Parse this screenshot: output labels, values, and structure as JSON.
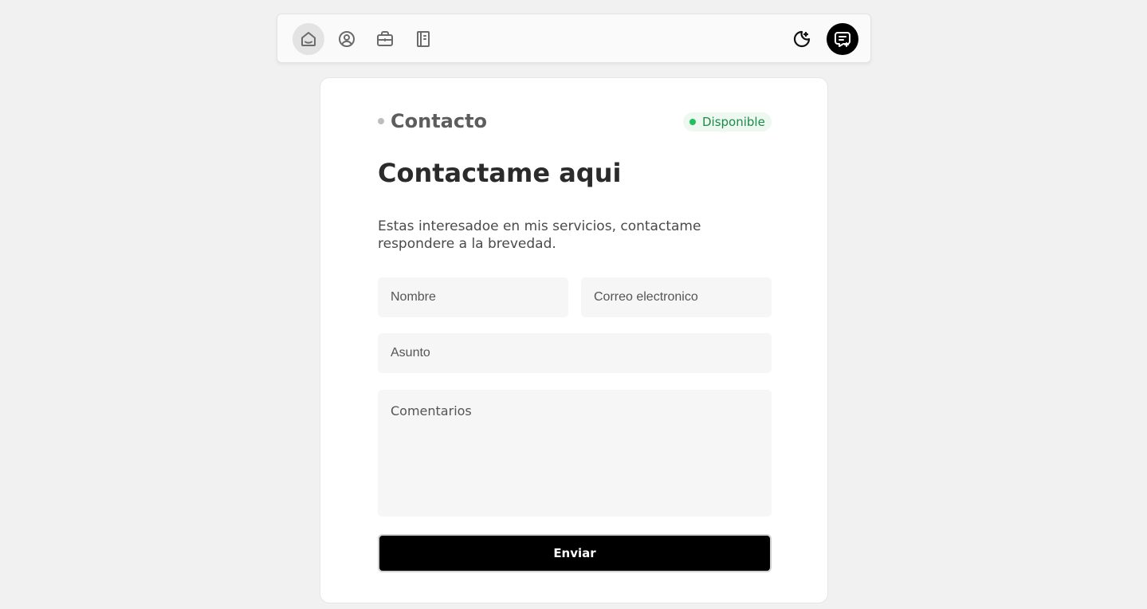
{
  "nav": {
    "items": [
      {
        "icon": "home-icon",
        "active": true
      },
      {
        "icon": "user-circle-icon",
        "active": false
      },
      {
        "icon": "briefcase-icon",
        "active": false
      },
      {
        "icon": "notebook-icon",
        "active": false
      }
    ],
    "theme_icon": "moon-icon",
    "chat_icon": "message-plus-icon"
  },
  "contact": {
    "section_label": "Contacto",
    "status_badge": "Disponible",
    "heading": "Contactame aqui",
    "description": "Estas interesadoe en mis servicios, contactame respondere a la brevedad.",
    "form": {
      "name_placeholder": "Nombre",
      "email_placeholder": "Correo electronico",
      "subject_placeholder": "Asunto",
      "comments_placeholder": "Comentarios",
      "submit_label": "Enviar"
    }
  },
  "colors": {
    "background": "#f1f1f1",
    "accent": "#000000",
    "status_green": "#1fc15e"
  }
}
